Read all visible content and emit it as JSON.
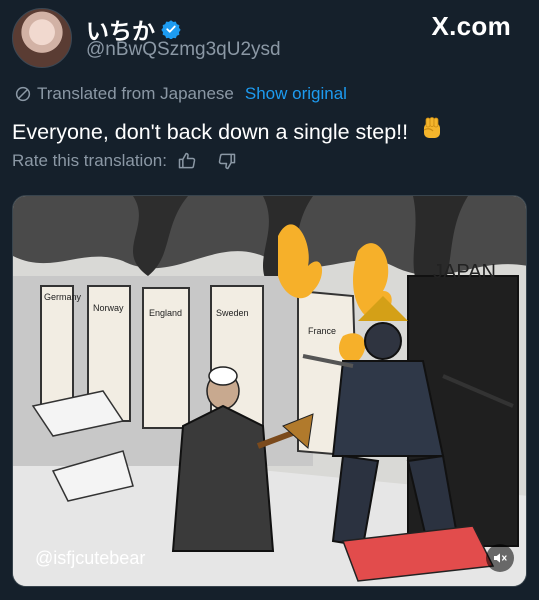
{
  "author": {
    "display_name": "いちか",
    "handle": "@nBwQSzmg3qU2ysd",
    "verified": true
  },
  "brand": "X.com",
  "translation": {
    "notice": "Translated from Japanese",
    "show_original": "Show original",
    "rate_prompt": "Rate this translation:"
  },
  "tweet": {
    "text": "Everyone, don't back down a single step!!",
    "emoji": "raised-fist"
  },
  "media": {
    "watermark": "@isfjcutebear",
    "doors": [
      "Germany",
      "Norway",
      "England",
      "Sweden",
      "France"
    ],
    "dark_door": "JAPAN",
    "icon": "volume-muted-icon"
  },
  "colors": {
    "background": "#15202b",
    "link": "#1d9bf0",
    "secondary": "#8b98a5",
    "verified": "#1d9bf0"
  }
}
